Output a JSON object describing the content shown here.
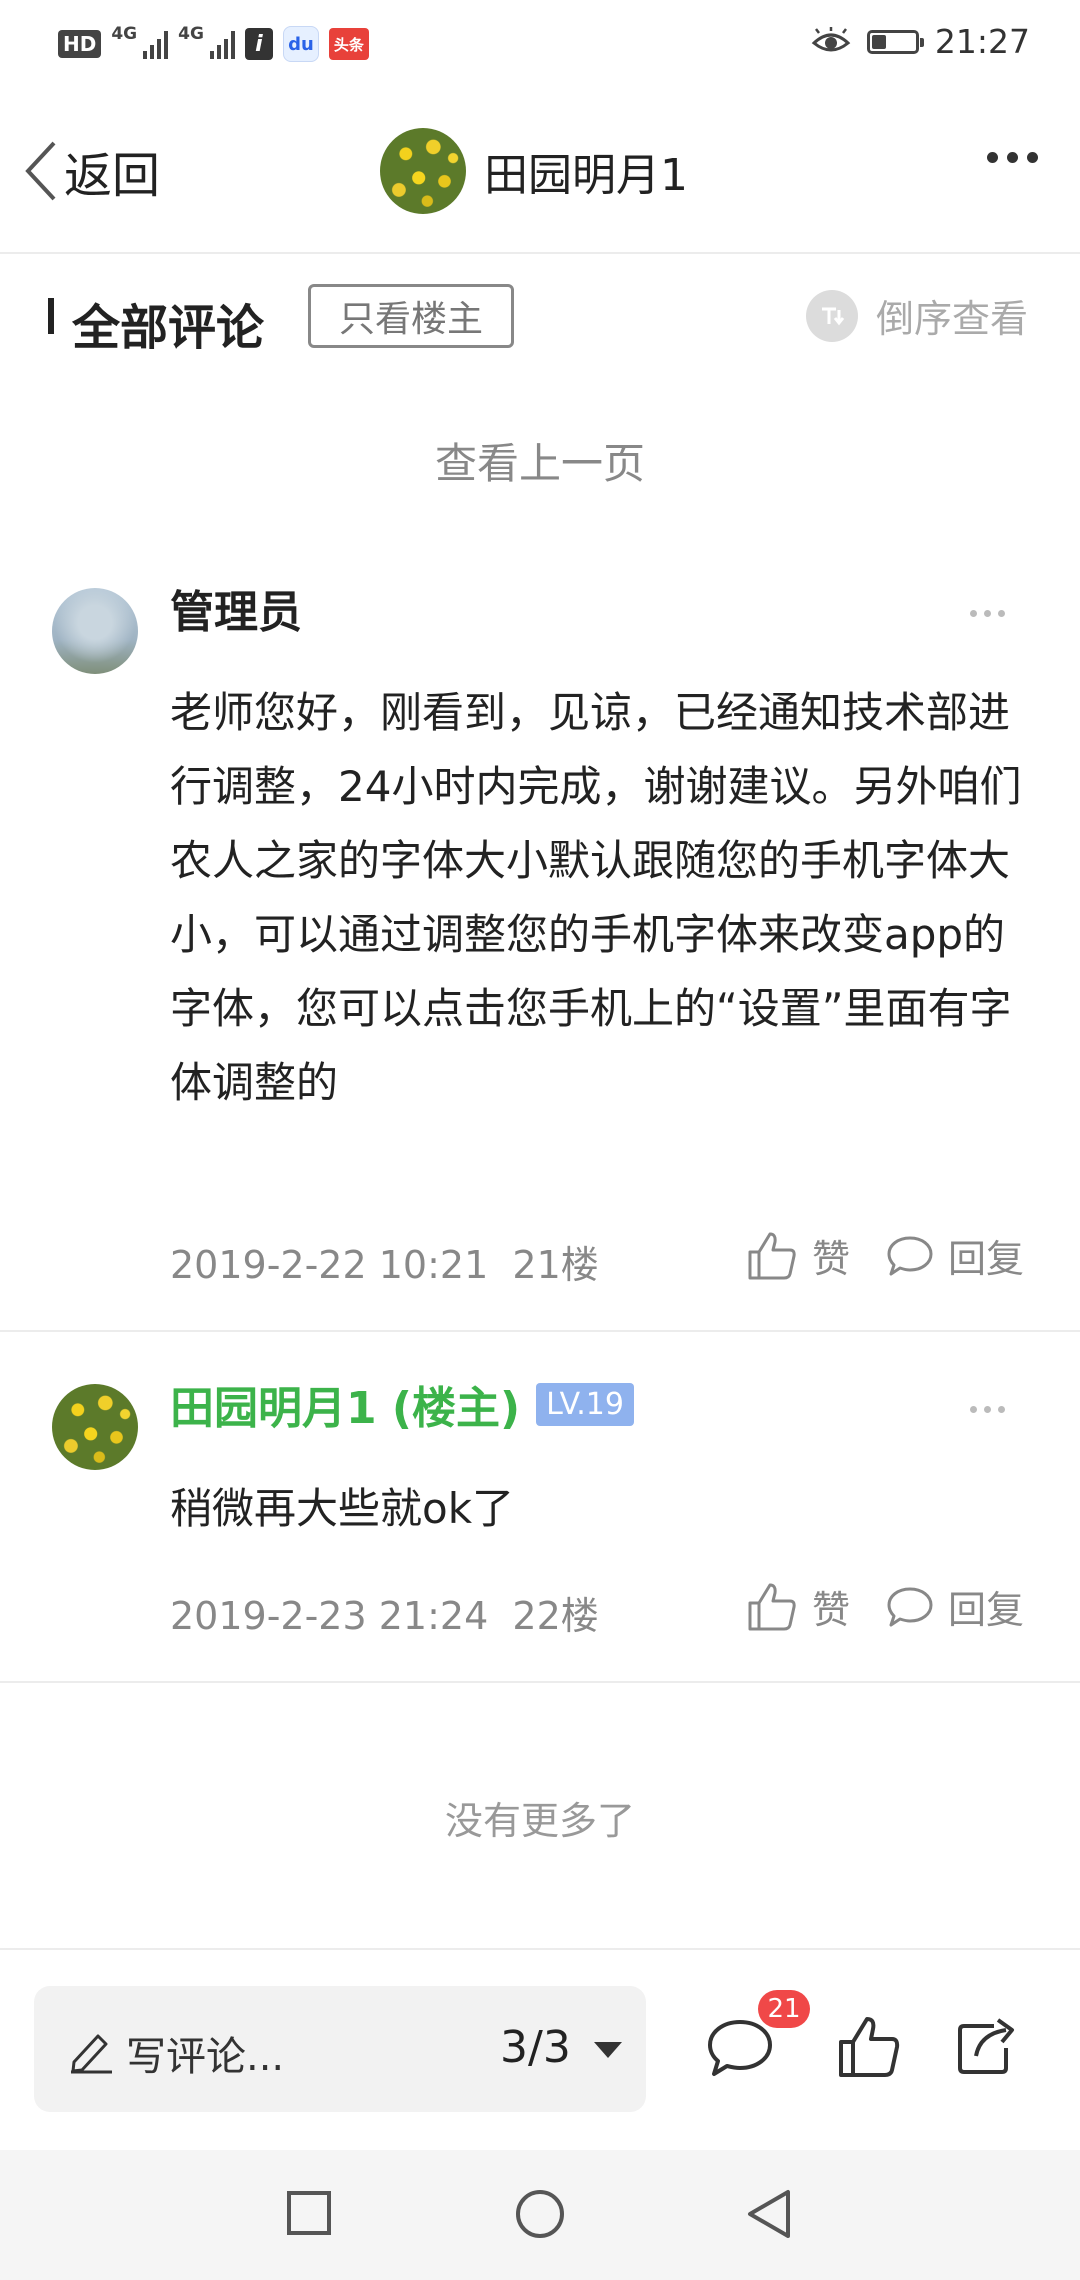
{
  "status_bar": {
    "hd": "HD",
    "network1": "4G",
    "network2": "4G",
    "app_icon_i": "i",
    "app_icon_baidu": "du",
    "app_icon_toutiao": "头条",
    "time": "21:27",
    "icons": [
      "signal-icon",
      "info-app-icon",
      "baidu-app-icon",
      "toutiao-app-icon",
      "eye-icon",
      "battery-icon"
    ]
  },
  "nav": {
    "back_label": "返回",
    "title": "田园明月1"
  },
  "section": {
    "title": "全部评论",
    "op_only": "只看楼主",
    "reverse": "倒序查看"
  },
  "prev_page": "查看上一页",
  "comments": [
    {
      "author": "管理员",
      "body": "老师您好，刚看到，见谅，已经通知技术部进行调整，24小时内完成，谢谢建议。另外咱们农人之家的字体大小默认跟随您的手机字体大小，可以通过调整您的手机字体来改变app的字体，您可以点击您手机上的“设置”里面有字体调整的",
      "date": "2019-2-22 10:21",
      "floor": "21楼",
      "like": "赞",
      "reply": "回复"
    },
    {
      "author": "田园明月1 (楼主)",
      "level": "LV.19",
      "body": "稍微再大些就ok了",
      "date": "2019-2-23 21:24",
      "floor": "22楼",
      "like": "赞",
      "reply": "回复"
    }
  ],
  "no_more": "没有更多了",
  "bottom_bar": {
    "compose_placeholder": "写评论...",
    "page_indicator": "3/3",
    "comment_count": "21"
  },
  "colors": {
    "op_name": "#3cb34a",
    "level_badge": "#8fb2ee",
    "count_badge": "#f04848"
  }
}
